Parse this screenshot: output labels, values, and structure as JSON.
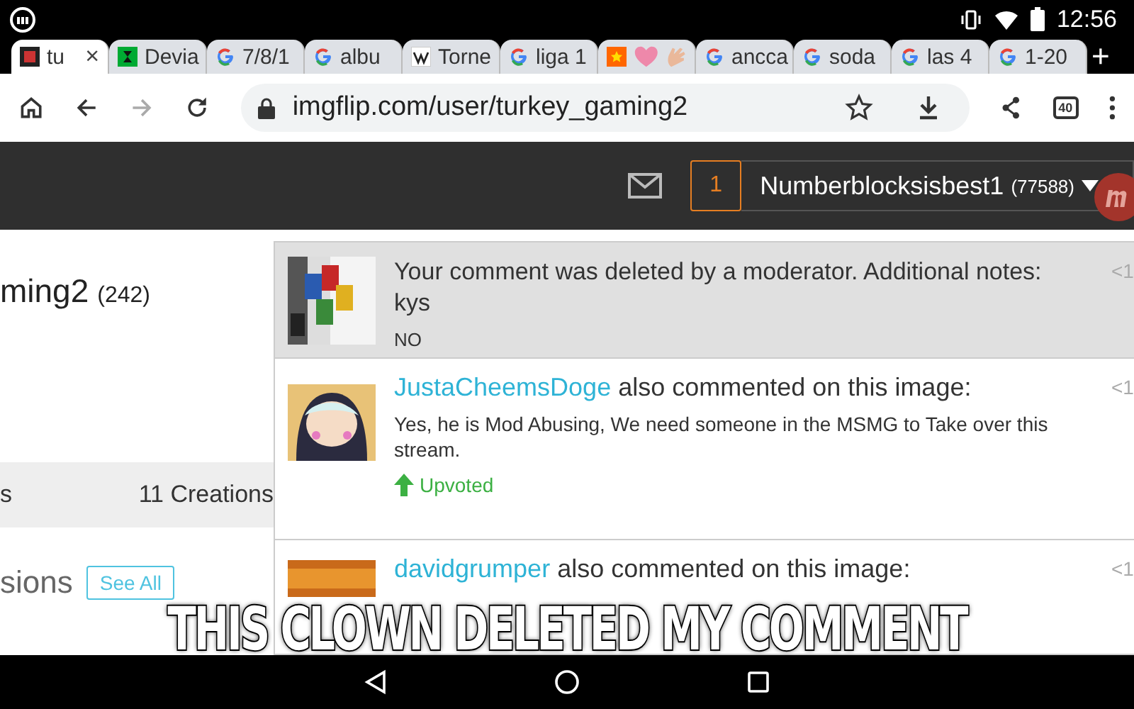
{
  "status_bar": {
    "time": "12:56"
  },
  "tabs": [
    {
      "label": "tu",
      "kind": "imgflip",
      "selected": true,
      "close": "×"
    },
    {
      "label": "Devia",
      "kind": "deviant",
      "selected": false
    },
    {
      "label": "7/8/1",
      "kind": "google",
      "selected": false
    },
    {
      "label": "albu",
      "kind": "google",
      "selected": false
    },
    {
      "label": "Torne",
      "kind": "wiki",
      "selected": false
    },
    {
      "label": "liga 1",
      "kind": "google",
      "selected": false
    },
    {
      "kind": "emoji",
      "selected": false
    },
    {
      "label": "ancca",
      "kind": "google",
      "selected": false
    },
    {
      "label": "soda",
      "kind": "google",
      "selected": false
    },
    {
      "label": "las 4",
      "kind": "google",
      "selected": false
    },
    {
      "label": "1-20",
      "kind": "google",
      "selected": false
    }
  ],
  "new_tab": "+",
  "address_bar": {
    "url": "imgflip.com/user/turkey_gaming2",
    "tab_count": "40",
    "forward_disabled": true
  },
  "site_header": {
    "notification_count": "1",
    "username": "Numberblocksisbest1",
    "points": "(77588)"
  },
  "profile": {
    "name": "ming2",
    "points": "(242)",
    "tab_1": "s",
    "tab_2": "11 Creations",
    "section": "sions",
    "see_all": "See All"
  },
  "notifications": [
    {
      "kind": "moderation",
      "unread": true,
      "text": "Your comment was deleted by a moderator. Additional notes: kys",
      "comment": "NO",
      "time": "<1"
    },
    {
      "kind": "comment",
      "unread": false,
      "user": "JustaCheemsDoge",
      "action": "also commented on this image:",
      "comment": "Yes, he is Mod Abusing, We need someone in the MSMG to Take over this stream.",
      "vote": "Upvoted",
      "time": "<1"
    },
    {
      "kind": "comment",
      "unread": false,
      "user": "davidgrumper",
      "action": "also commented on this image:",
      "time": "<1"
    }
  ],
  "caption": "THIS CLOWN DELETED MY COMMENT"
}
